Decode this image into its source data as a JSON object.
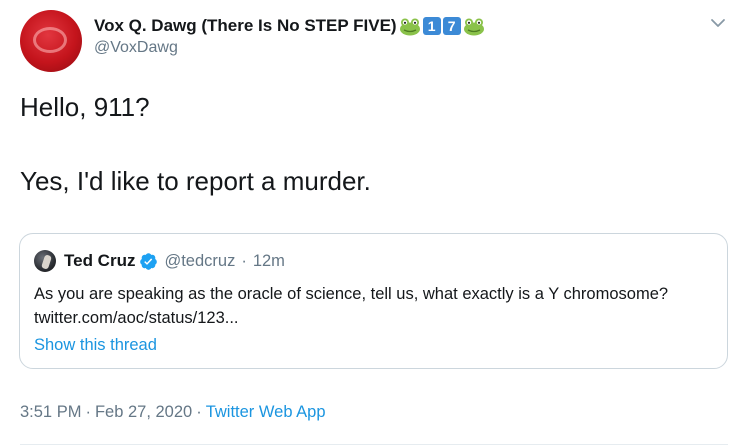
{
  "tweet": {
    "author": {
      "display_name": "Vox Q. Dawg (There Is No STEP FIVE)",
      "name_emojis": [
        "frog-emoji",
        "keycap-1",
        "keycap-7",
        "frog-emoji"
      ],
      "keycap_1": "1",
      "keycap_7": "7",
      "handle": "@VoxDawg"
    },
    "body_line_1": "Hello, 911?",
    "body_line_2": "Yes, I'd like to report a murder.",
    "quoted": {
      "display_name": "Ted Cruz",
      "verified": true,
      "handle": "@tedcruz",
      "separator": "·",
      "time": "12m",
      "text": "As you are speaking as the oracle of science, tell us, what exactly is a Y chromosome? twitter.com/aoc/status/123...",
      "show_thread": "Show this thread"
    },
    "footer": {
      "time": "3:51 PM",
      "separator": "·",
      "date": "Feb 27, 2020",
      "app": "Twitter Web App"
    }
  },
  "colors": {
    "link": "#1b95e0",
    "secondary_text": "#657786",
    "border": "#ccd6dd",
    "keycap_blue": "#3c8ad6",
    "frog_green": "#8ac24a"
  }
}
